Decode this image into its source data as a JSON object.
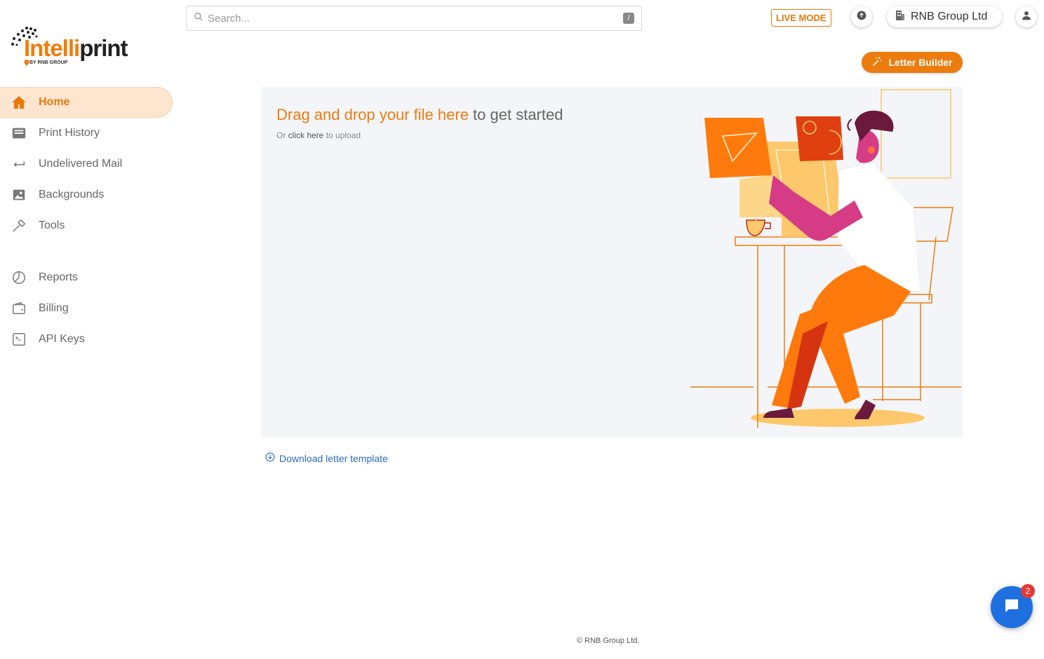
{
  "brand": {
    "logo_part1": "Intelli",
    "logo_part2": "print",
    "logo_sub": "BY RNB GROUP",
    "accent": "#ec7c0e"
  },
  "search": {
    "placeholder": "Search...",
    "shortcut": "/"
  },
  "header": {
    "mode_label": "LIVE MODE",
    "org_name": "RNB Group Ltd",
    "upload_icon": "arrow-up-circle-icon",
    "user_icon": "user-icon"
  },
  "sidebar": {
    "items": [
      {
        "label": "Home",
        "icon": "home-icon",
        "active": true
      },
      {
        "label": "Print History",
        "icon": "printer-tray-icon"
      },
      {
        "label": "Undelivered Mail",
        "icon": "return-arrow-icon"
      },
      {
        "label": "Backgrounds",
        "icon": "image-icon"
      },
      {
        "label": "Tools",
        "icon": "hammer-icon"
      },
      {
        "label": "Reports",
        "icon": "pie-chart-icon"
      },
      {
        "label": "Billing",
        "icon": "wallet-icon"
      },
      {
        "label": "API Keys",
        "icon": "terminal-icon"
      }
    ]
  },
  "main": {
    "letter_builder": "Letter Builder",
    "dropzone": {
      "title_highlight": "Drag and drop your file here",
      "title_rest": " to get started",
      "sub_prefix": "Or ",
      "sub_link": "click here",
      "sub_suffix": " to upload"
    },
    "download_link": "Download letter template"
  },
  "footer": {
    "copyright": "© RNB Group Ltd."
  },
  "chat": {
    "badge_count": "2"
  }
}
